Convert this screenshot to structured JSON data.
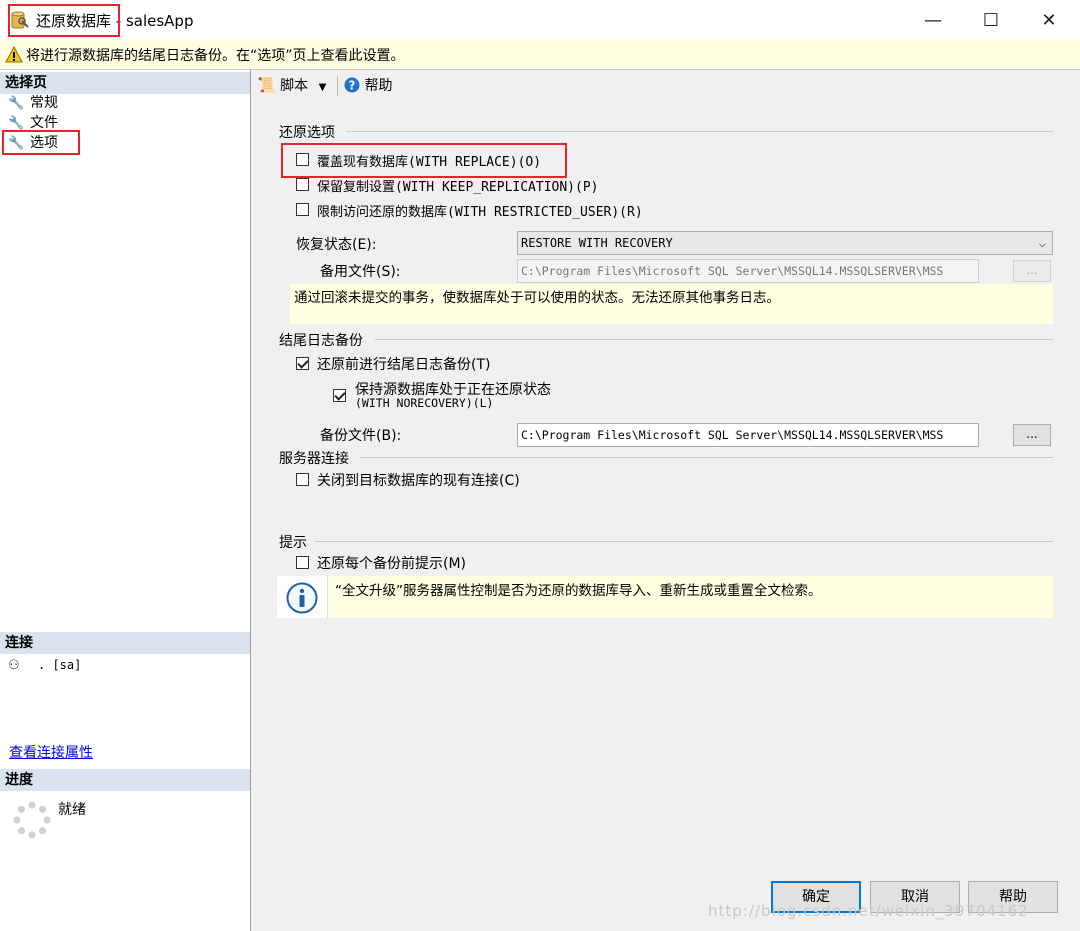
{
  "window": {
    "title": "还原数据库 - salesApp",
    "minimize_glyph": "—",
    "maximize_glyph": "☐",
    "close_glyph": "✕"
  },
  "warning": {
    "icon": "warning-icon",
    "text": "将进行源数据库的结尾日志备份。在“选项”页上查看此设置。"
  },
  "left": {
    "select_page_header": "选择页",
    "pages": [
      {
        "label": "常规"
      },
      {
        "label": "文件"
      },
      {
        "label": "选项"
      }
    ],
    "connection_header": "连接",
    "connection_text": ". [sa]",
    "view_connection_link": "查看连接属性",
    "progress_header": "进度",
    "progress_status": "就绪"
  },
  "toolbar": {
    "script_label": "脚本",
    "help_label": "帮助"
  },
  "restore_options": {
    "title": "还原选项",
    "overwrite": {
      "label": "覆盖现有数据库(WITH REPLACE)(O)",
      "checked": false
    },
    "keep_replication": {
      "label": "保留复制设置(WITH KEEP_REPLICATION)(P)",
      "checked": false
    },
    "restrict_access": {
      "label": "限制访问还原的数据库(WITH RESTRICTED_USER)(R)",
      "checked": false
    },
    "recovery_state_label": "恢复状态(E):",
    "recovery_state_value": "RESTORE WITH RECOVERY",
    "standby_file_label": "备用文件(S):",
    "standby_file_value": "C:\\Program Files\\Microsoft SQL Server\\MSSQL14.MSSQLSERVER\\MSS",
    "browse_label": "...",
    "description": "通过回滚未提交的事务，使数据库处于可以使用的状态。无法还原其他事务日志。"
  },
  "tail_log": {
    "title": "结尾日志备份",
    "take_backup": {
      "label": "还原前进行结尾日志备份(T)",
      "checked": true
    },
    "leave_restoring_line1": "保持源数据库处于正在还原状态",
    "leave_restoring_line2": "(WITH NORECOVERY)(L)",
    "leave_restoring_checked": true,
    "backup_file_label": "备份文件(B):",
    "backup_file_value": "C:\\Program Files\\Microsoft SQL Server\\MSSQL14.MSSQLSERVER\\MSS",
    "browse_label": "..."
  },
  "server_connections": {
    "title": "服务器连接",
    "close_connections": {
      "label": "关闭到目标数据库的现有连接(C)",
      "checked": false
    }
  },
  "prompt": {
    "title": "提示",
    "prompt_before": {
      "label": "还原每个备份前提示(M)",
      "checked": false
    },
    "info_text": "“全文升级”服务器属性控制是否为还原的数据库导入、重新生成或重置全文检索。"
  },
  "buttons": {
    "ok": "确定",
    "cancel": "取消",
    "help": "帮助"
  },
  "watermark": "http://blog.csdn.net/weixin_39704162"
}
